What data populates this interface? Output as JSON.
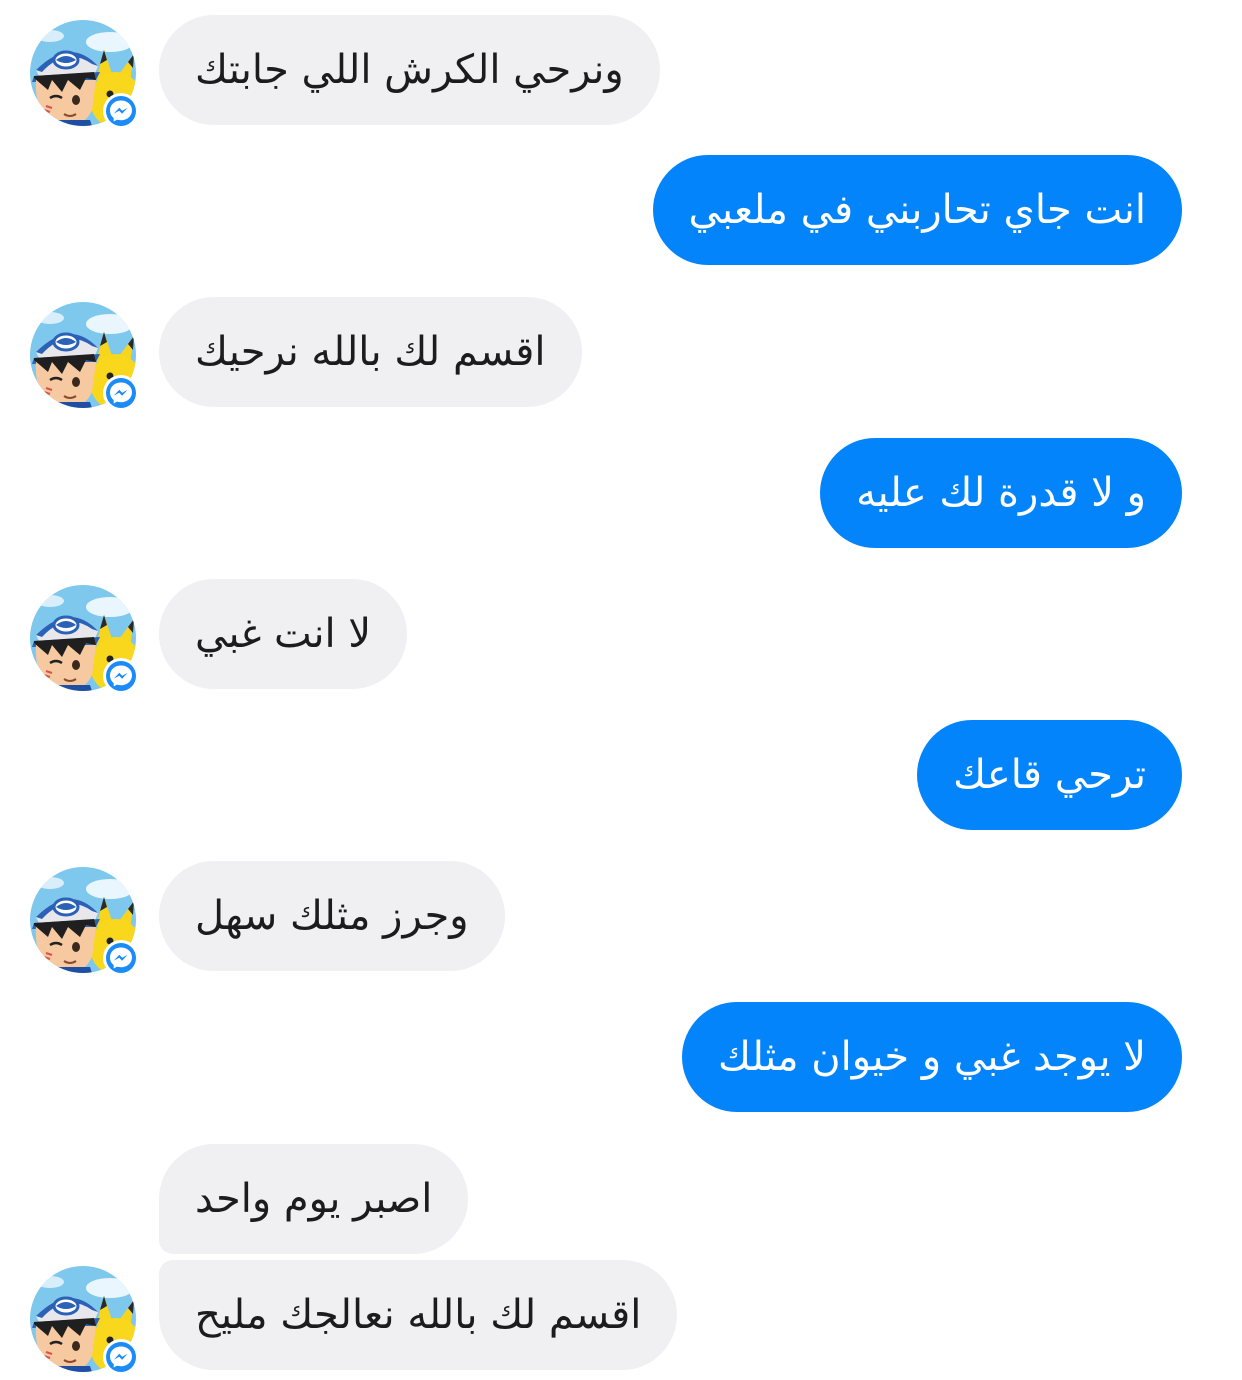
{
  "contact": {
    "avatar_icon": "pokemon-trainer-avatar",
    "badge_icon": "messenger-icon",
    "incoming_color": "#f0eff1",
    "outgoing_color": "#0484fb"
  },
  "messages": [
    {
      "direction": "in",
      "text": "ونرحي الكرش اللي جابتك"
    },
    {
      "direction": "out",
      "text": "انت جاي تحاربني في ملعبي"
    },
    {
      "direction": "in",
      "text": "اقسم لك بالله نرحيك"
    },
    {
      "direction": "out",
      "text": "و لا قدرة لك عليه"
    },
    {
      "direction": "in",
      "text": "لا انت غبي"
    },
    {
      "direction": "out",
      "text": "ترحي قاعك"
    },
    {
      "direction": "in",
      "text": "وجرز مثلك سهل"
    },
    {
      "direction": "out",
      "text": "لا يوجد غبي و خيوان مثلك"
    },
    {
      "direction": "in",
      "text": "اصبر يوم واحد"
    },
    {
      "direction": "in",
      "text": "اقسم لك بالله نعالجك مليح"
    }
  ]
}
